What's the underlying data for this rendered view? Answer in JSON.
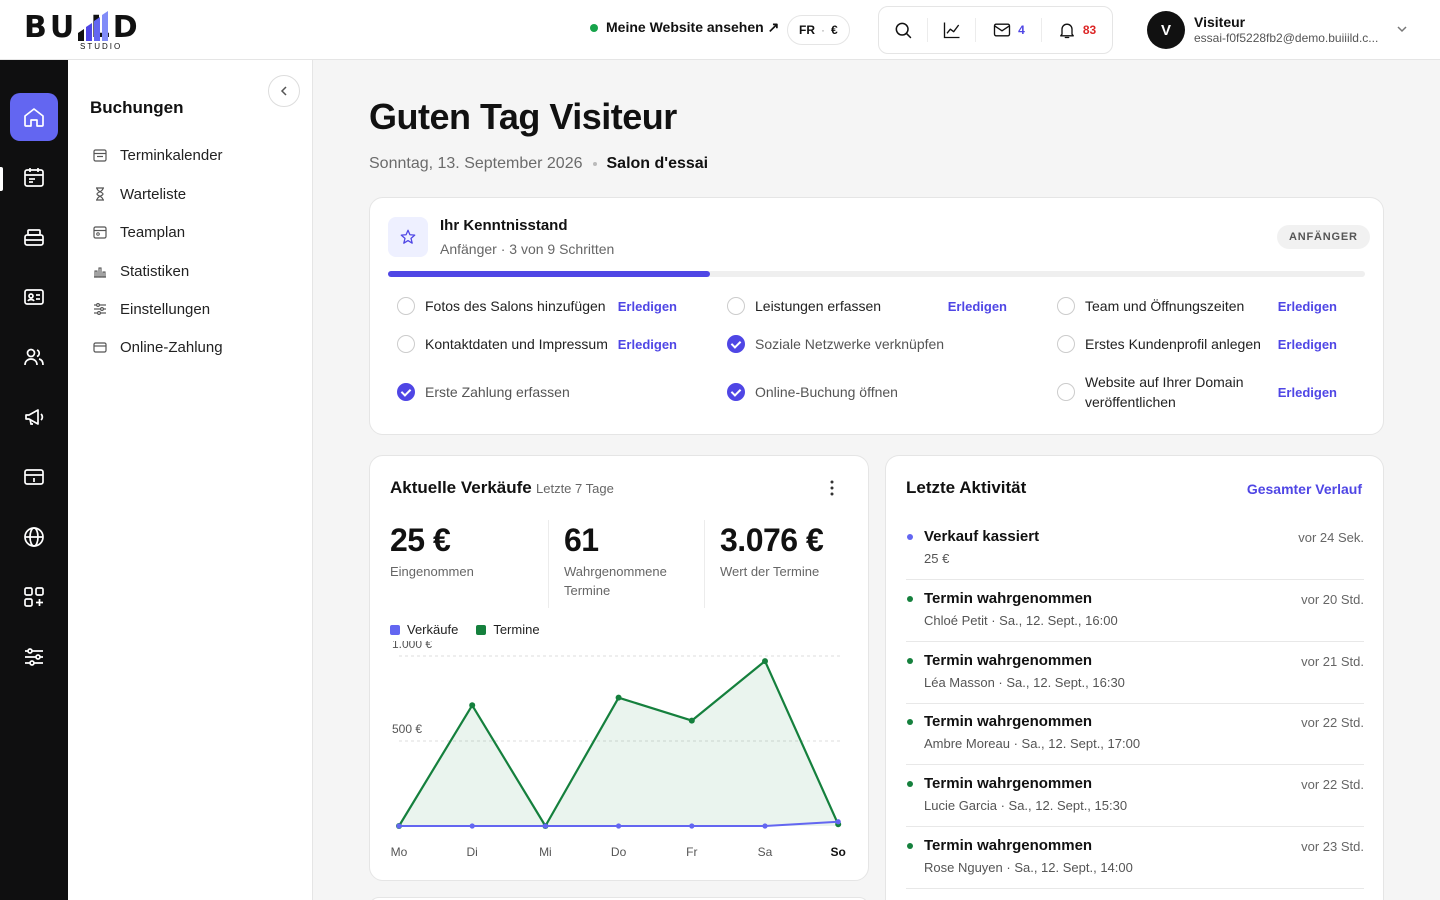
{
  "brand": {
    "word": "BU  LD",
    "sub": "STUDIO"
  },
  "topbar": {
    "site_link": "Meine Website ansehen ↗",
    "lang": "FR",
    "currency": "€",
    "mail_count": "4",
    "notif_count": "83",
    "user_initial": "V",
    "user_name": "Visiteur",
    "user_email": "essai-f0f5228fb2@demo.buiiild.c..."
  },
  "rail": [
    "home-icon",
    "calendar-icon",
    "register-icon",
    "contact-card-icon",
    "users-icon",
    "megaphone-icon",
    "payment-icon",
    "globe-icon",
    "apps-icon",
    "settings-sliders-icon"
  ],
  "sidebar": {
    "title": "Buchungen",
    "items": [
      {
        "label": "Terminkalender",
        "icon": "calendar-icon"
      },
      {
        "label": "Warteliste",
        "icon": "hourglass-icon"
      },
      {
        "label": "Teamplan",
        "icon": "team-calendar-icon"
      },
      {
        "label": "Statistiken",
        "icon": "stats-icon"
      },
      {
        "label": "Einstellungen",
        "icon": "sliders-icon"
      },
      {
        "label": "Online-Zahlung",
        "icon": "card-icon"
      }
    ]
  },
  "main": {
    "greeting": "Guten Tag Visiteur",
    "date": "Sonntag, 13. September 2026",
    "salon": "Salon d'essai"
  },
  "knowledge": {
    "title": "Ihr Kenntnisstand",
    "subtitle": "Anfänger · 3 von 9 Schritten",
    "badge": "ANFÄNGER",
    "progress": 0.33,
    "action_label": "Erledigen",
    "steps": [
      {
        "label": "Fotos des Salons hinzufügen",
        "done": false
      },
      {
        "label": "Leistungen erfassen",
        "done": false
      },
      {
        "label": "Team und Öffnungszeiten",
        "done": false
      },
      {
        "label": "Kontaktdaten und Impressum",
        "done": false
      },
      {
        "label": "Soziale Netzwerke verknüpfen",
        "done": true
      },
      {
        "label": "Erstes Kundenprofil anlegen",
        "done": false
      },
      {
        "label": "Erste Zahlung erfassen",
        "done": true
      },
      {
        "label": "Online-Buchung öffnen",
        "done": true
      },
      {
        "label": "Website auf Ihrer Domain veröffentlichen",
        "done": false
      }
    ]
  },
  "sales": {
    "title": "Aktuelle Verkäufe",
    "range": "Letzte 7 Tage",
    "kpis": [
      {
        "value": "25 €",
        "label": "Eingenommen"
      },
      {
        "value": "61",
        "label": "Wahrgenommene Termine"
      },
      {
        "value": "3.076 €",
        "label": "Wert der Termine"
      }
    ]
  },
  "chart_data": {
    "type": "area",
    "categories": [
      "Mo",
      "Di",
      "Mi",
      "Do",
      "Fr",
      "Sa",
      "So"
    ],
    "highlight_category": "So",
    "series": [
      {
        "name": "Verkäufe",
        "color": "#6366f1",
        "values": [
          0,
          0,
          0,
          0,
          0,
          0,
          25
        ]
      },
      {
        "name": "Termine",
        "color": "#15803d",
        "values": [
          0,
          710,
          0,
          755,
          620,
          970,
          10
        ]
      }
    ],
    "yticks": [
      {
        "value": 500,
        "label": "500 €"
      },
      {
        "value": 1000,
        "label": "1.000 €"
      }
    ],
    "ylim": [
      0,
      1000
    ],
    "grid": true,
    "legend": "top-left"
  },
  "activity": {
    "title": "Letzte Aktivität",
    "link": "Gesamter Verlauf",
    "items": [
      {
        "title": "Verkauf kassiert",
        "detail": "25 €",
        "ago": "vor 24 Sek.",
        "color": "#6366f1"
      },
      {
        "title": "Termin wahrgenommen",
        "detail": "Chloé Petit · Sa., 12. Sept., 16:00",
        "ago": "vor 20 Std.",
        "color": "#15803d"
      },
      {
        "title": "Termin wahrgenommen",
        "detail": "Léa Masson · Sa., 12. Sept., 16:30",
        "ago": "vor 21 Std.",
        "color": "#15803d"
      },
      {
        "title": "Termin wahrgenommen",
        "detail": "Ambre Moreau · Sa., 12. Sept., 17:00",
        "ago": "vor 22 Std.",
        "color": "#15803d"
      },
      {
        "title": "Termin wahrgenommen",
        "detail": "Lucie Garcia · Sa., 12. Sept., 15:30",
        "ago": "vor 22 Std.",
        "color": "#15803d"
      },
      {
        "title": "Termin wahrgenommen",
        "detail": "Rose Nguyen · Sa., 12. Sept., 14:00",
        "ago": "vor 23 Std.",
        "color": "#15803d"
      }
    ]
  }
}
